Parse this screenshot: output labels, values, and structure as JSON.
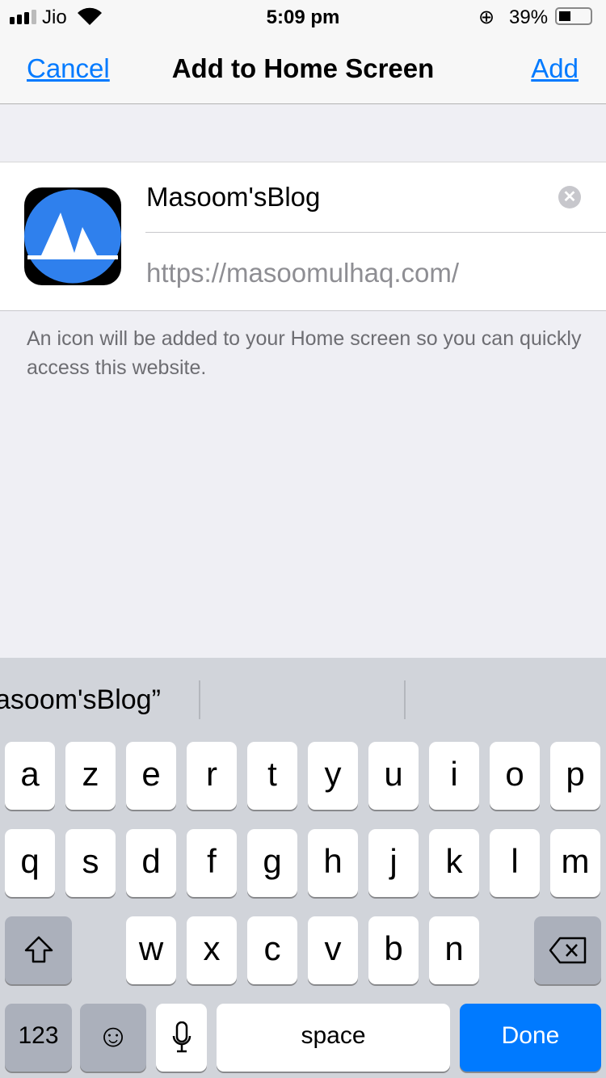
{
  "status": {
    "carrier": "Jio",
    "time": "5:09 pm",
    "battery": "39%",
    "battery_level": 0.39
  },
  "nav": {
    "cancel": "Cancel",
    "title": "Add to Home Screen",
    "add": "Add"
  },
  "form": {
    "name_value": "Masoom'sBlog",
    "url": "https://masoomulhaq.com/",
    "icon_color": "#2f80ed"
  },
  "hint": "An icon will be added to your Home screen so you can quickly access this website.",
  "keyboard": {
    "suggestion": "asoom'sBlog”",
    "row1": [
      "a",
      "z",
      "e",
      "r",
      "t",
      "y",
      "u",
      "i",
      "o",
      "p"
    ],
    "row2": [
      "q",
      "s",
      "d",
      "f",
      "g",
      "h",
      "j",
      "k",
      "l",
      "m"
    ],
    "row3": [
      "w",
      "x",
      "c",
      "v",
      "b",
      "n"
    ],
    "numbers": "123",
    "space": "space",
    "done": "Done",
    "done_color": "#007aff"
  }
}
